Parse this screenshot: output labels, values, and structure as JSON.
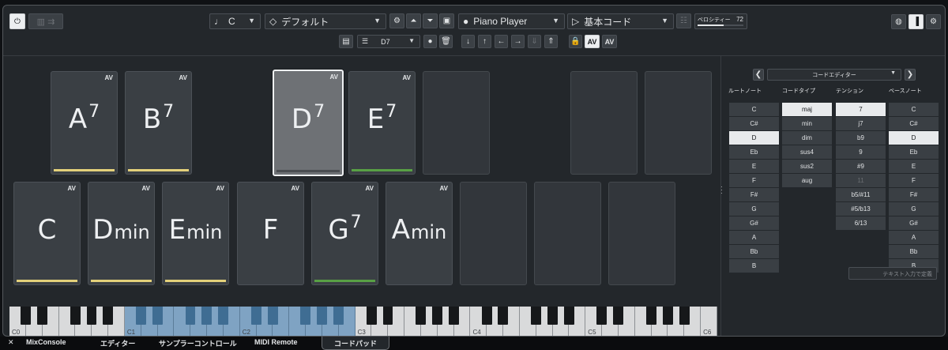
{
  "toolbar": {
    "key_value": "C",
    "preset_value": "デフォルト",
    "player_value": "Piano Player",
    "mode_value": "基本コード",
    "velocity_label": "ベロシティー",
    "velocity_value": "72",
    "velocity_fraction": 0.57,
    "chord_value": "D7",
    "av_label": "AV"
  },
  "pads": {
    "av": "AV",
    "top": [
      {
        "root": "A",
        "ext": "7",
        "min": "",
        "bar": "yellow"
      },
      {
        "root": "B",
        "ext": "7",
        "min": "",
        "bar": "yellow"
      },
      {
        "root": "D",
        "ext": "7",
        "min": "",
        "bar": "",
        "selected": true
      },
      {
        "root": "E",
        "ext": "7",
        "min": "",
        "bar": "green"
      }
    ],
    "bottom": [
      {
        "root": "C",
        "ext": "",
        "min": "",
        "bar": "yellow"
      },
      {
        "root": "D",
        "ext": "",
        "min": "min",
        "bar": "yellow"
      },
      {
        "root": "E",
        "ext": "",
        "min": "min",
        "bar": "yellow"
      },
      {
        "root": "F",
        "ext": "",
        "min": "",
        "bar": ""
      },
      {
        "root": "G",
        "ext": "7",
        "min": "",
        "bar": "green"
      },
      {
        "root": "A",
        "ext": "",
        "min": "min",
        "bar": ""
      }
    ]
  },
  "colors": {
    "yellow": "#e3d07a",
    "green": "#58a045",
    "accent_key": "#7fa3c3"
  },
  "editor": {
    "title": "コードエディター",
    "headers": [
      "ルートノート",
      "コードタイプ",
      "テンション",
      "ベースノート"
    ],
    "roots": [
      "C",
      "C#",
      "D",
      "Eb",
      "E",
      "F",
      "F#",
      "G",
      "G#",
      "A",
      "Bb",
      "B"
    ],
    "root_selected": "D",
    "types": [
      "maj",
      "min",
      "dim",
      "sus4",
      "sus2",
      "aug"
    ],
    "type_selected": "maj",
    "tensions": [
      "7",
      "j7",
      "b9",
      "9",
      "#9",
      "11",
      "b5/#11",
      "#5/b13",
      "6/13"
    ],
    "tension_selected": "7",
    "tension_disabled": "11",
    "bass": [
      "C",
      "C#",
      "D",
      "Eb",
      "E",
      "F",
      "F#",
      "G",
      "G#",
      "A",
      "Bb",
      "B"
    ],
    "bass_selected": "D",
    "text_input_placeholder": "テキスト入力で定義"
  },
  "keyboard": {
    "octaves": [
      "C0",
      "C1",
      "C2",
      "C3",
      "C4",
      "C5",
      "C6"
    ]
  },
  "tabs": {
    "close": "✕",
    "items": [
      "MixConsole",
      "エディター",
      "サンプラーコントロール",
      "MIDI Remote",
      "コードパッド"
    ],
    "active": "コードパッド"
  }
}
